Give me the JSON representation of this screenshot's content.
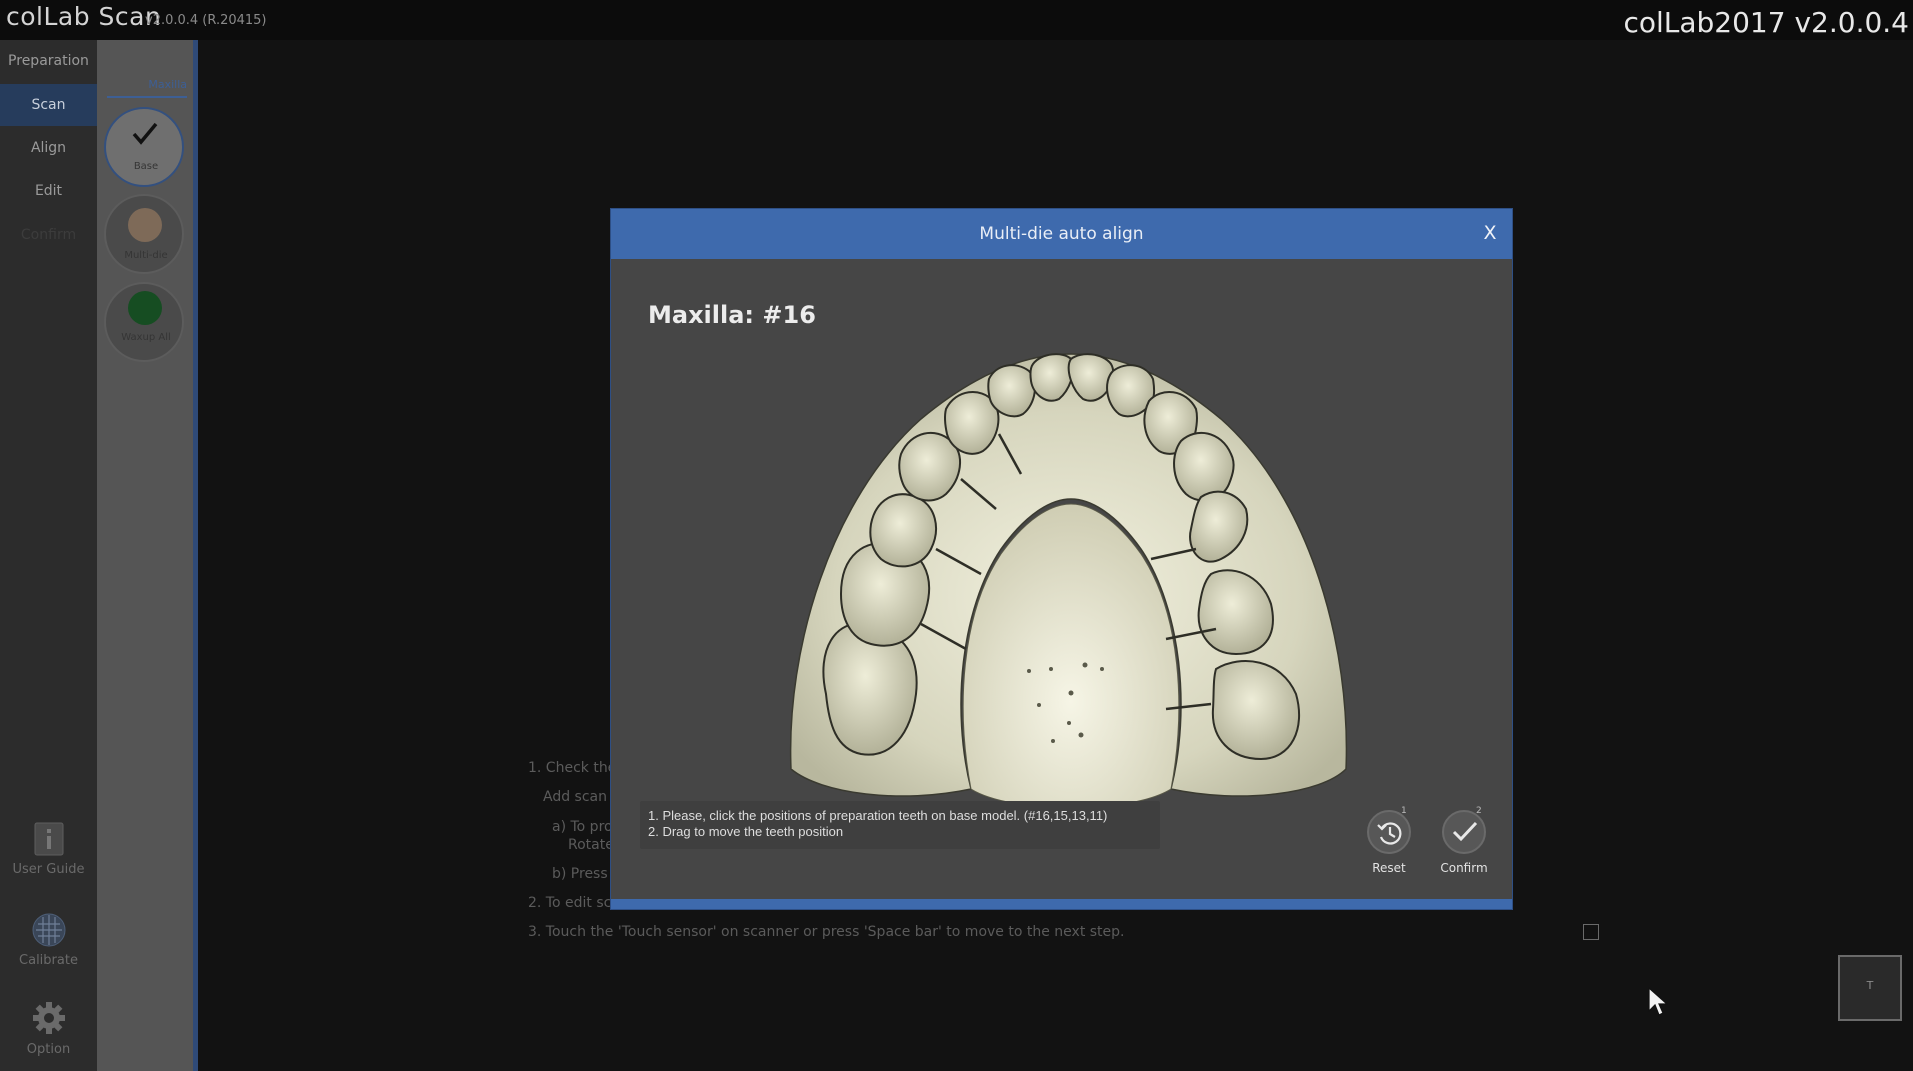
{
  "app": {
    "logo": "colLab Scan",
    "version": "v2.0.0.4 (R.20415)",
    "window_title": "colLab2017 v2.0.0.4"
  },
  "nav": {
    "items": [
      {
        "label": "Preparation",
        "state": "normal"
      },
      {
        "label": "Scan",
        "state": "active"
      },
      {
        "label": "Align",
        "state": "normal"
      },
      {
        "label": "Edit",
        "state": "normal"
      },
      {
        "label": "Confirm",
        "state": "disabled"
      }
    ],
    "utilities": [
      {
        "label": "User Guide",
        "icon": "info-icon"
      },
      {
        "label": "Calibrate",
        "icon": "calibrate-icon"
      },
      {
        "label": "Option",
        "icon": "gear-icon"
      }
    ]
  },
  "panel": {
    "tab_label": "Maxilla",
    "steps": [
      {
        "label": "Base",
        "status": "done",
        "icon": "checkmark-icon"
      },
      {
        "label": "Multi-die",
        "status": "pending",
        "color": "#b08a6a"
      },
      {
        "label": "Waxup All",
        "status": "pending",
        "color": "#1f6b2d"
      }
    ]
  },
  "background_instructions": {
    "line1": "1. Check the",
    "line2": "Add scan",
    "line3": "a) To pro",
    "line4": "Rotate",
    "line5": "b) Press",
    "line6": "2. To edit sc",
    "line7": "3. Touch the 'Touch sensor' on scanner or press 'Space bar' to move to the next step."
  },
  "modal": {
    "title": "Multi-die auto align",
    "close_label": "X",
    "heading": "Maxilla: #16",
    "instructions": [
      "1. Please, click the positions of preparation teeth on base model. (#16,15,13,11)",
      "2. Drag to move the teeth position"
    ],
    "buttons": [
      {
        "label": "Reset",
        "number": "1",
        "icon": "reset-history-icon"
      },
      {
        "label": "Confirm",
        "number": "2",
        "icon": "checkmark-icon"
      }
    ]
  },
  "view_cube": {
    "label": "T"
  },
  "colors": {
    "accent": "#3e6aad",
    "nav_active": "#263c5c",
    "model": "#d9d8c0"
  }
}
